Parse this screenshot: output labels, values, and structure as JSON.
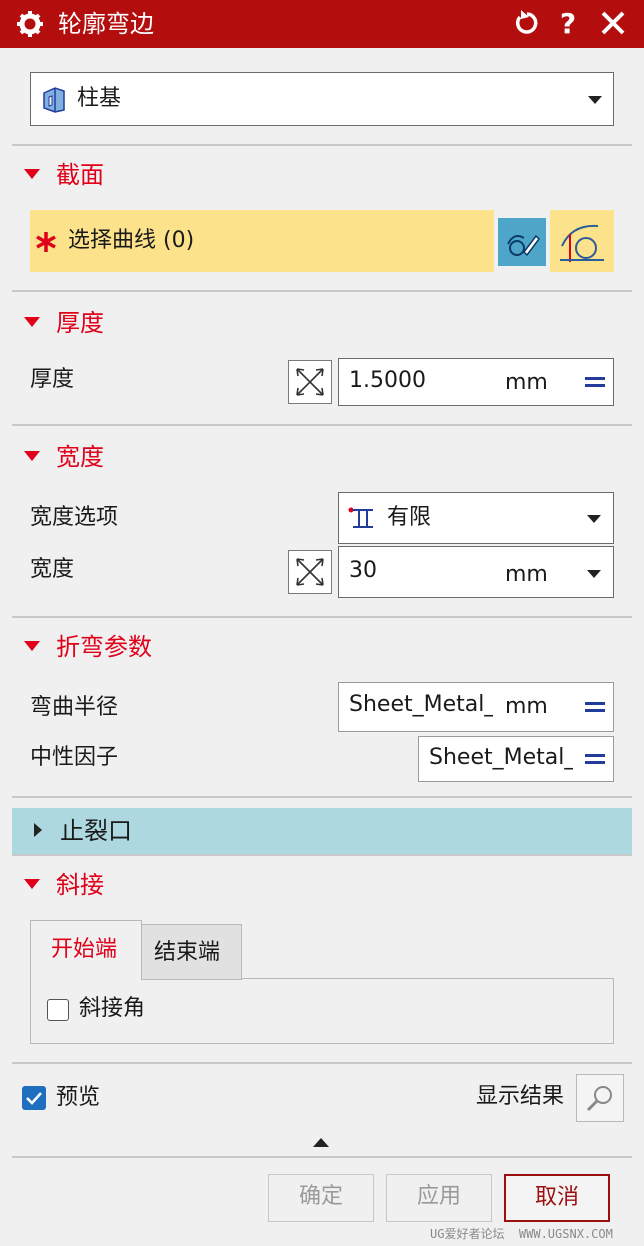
{
  "window": {
    "title": "轮廓弯边"
  },
  "type_select": {
    "value": "柱基"
  },
  "section": {
    "header": "截面",
    "select_curve_label": "选择曲线 (0)"
  },
  "thickness": {
    "header": "厚度",
    "label": "厚度",
    "value": "1.5000",
    "unit": "mm"
  },
  "width": {
    "header": "宽度",
    "option_label": "宽度选项",
    "option_value": "有限",
    "label": "宽度",
    "value": "30",
    "unit": "mm"
  },
  "bend": {
    "header": "折弯参数",
    "radius_label": "弯曲半径",
    "radius_value": "Sheet_Metal_",
    "radius_unit": "mm",
    "neutral_label": "中性因子",
    "neutral_value": "Sheet_Metal_"
  },
  "relief": {
    "header": "止裂口"
  },
  "miter": {
    "header": "斜接",
    "tabs": [
      "开始端",
      "结束端"
    ],
    "checkbox_label": "斜接角",
    "checkbox_checked": false
  },
  "preview": {
    "label": "预览",
    "checked": true,
    "show_result_label": "显示结果"
  },
  "buttons": {
    "ok": "确定",
    "apply": "应用",
    "cancel": "取消"
  },
  "watermark": "UG爱好者论坛  WWW.UGSNX.COM",
  "colors": {
    "title_bg": "#b30d0d",
    "section_header": "#e0001a",
    "selection_bg": "#fce28a",
    "relief_bg": "#add8df"
  }
}
